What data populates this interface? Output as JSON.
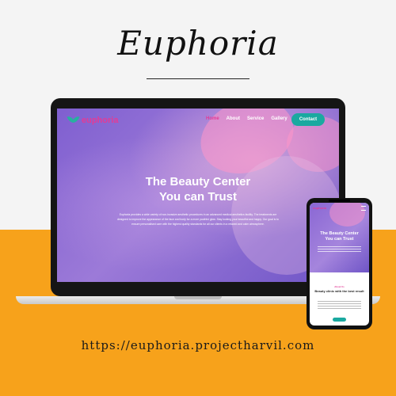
{
  "brand": {
    "script_title": "Euphoria"
  },
  "site": {
    "logo_text": "euphoria",
    "nav": {
      "links": [
        {
          "label": "Home"
        },
        {
          "label": "About"
        },
        {
          "label": "Service"
        },
        {
          "label": "Gallery"
        }
      ],
      "contact_label": "Contact"
    },
    "hero": {
      "title_line1": "The Beauty Center",
      "title_line2": "You can Trust",
      "description": "Euphoria provides a wide variety of non-invasive aesthetic procedures in an advanced medical aesthetics facility. The treatments are designed to improve the appearance of the face and body for a more youthful glow. Stay looking your beautiful and happy. Our goal is to ensure personalised care with the highest quality standards for all our clients in a relaxed and calm atmosphere."
    }
  },
  "mobile": {
    "logo_text": "euphoria",
    "title_line1": "The Beauty Center",
    "title_line2": "You can Trust",
    "about_tag": "About Us",
    "section_title": "Beauty clinic with the best result"
  },
  "footer": {
    "url": "https://euphoria.projectharvil.com"
  },
  "colors": {
    "accent_pink": "#e23c96",
    "accent_teal": "#1aa9a0",
    "orange": "#f7a21b"
  }
}
